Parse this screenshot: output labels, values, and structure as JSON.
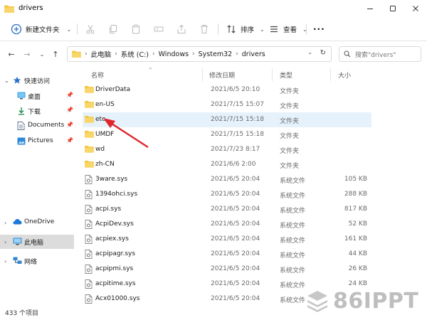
{
  "window": {
    "title": "drivers",
    "controls": [
      "minimize",
      "maximize",
      "close"
    ]
  },
  "toolbar": {
    "new_label": "新建文件夹",
    "sort_label": "排序",
    "view_label": "查看",
    "more_label": "···"
  },
  "address": {
    "breadcrumbs": [
      "此电脑",
      "系统 (C:)",
      "Windows",
      "System32",
      "drivers"
    ],
    "search_placeholder": "搜索\"drivers\""
  },
  "sidebar": {
    "items": [
      {
        "label": "快速访问",
        "icon": "star-icon",
        "expandable": true
      },
      {
        "label": "桌面",
        "icon": "desktop-icon",
        "pinned": true
      },
      {
        "label": "下载",
        "icon": "download-icon",
        "pinned": true
      },
      {
        "label": "Documents",
        "icon": "documents-icon",
        "pinned": true
      },
      {
        "label": "Pictures",
        "icon": "pictures-icon",
        "pinned": true
      },
      {
        "label": "OneDrive",
        "icon": "onedrive-icon",
        "expandable": true
      },
      {
        "label": "此电脑",
        "icon": "this-pc-icon",
        "expandable": true,
        "selected": true
      },
      {
        "label": "网络",
        "icon": "network-icon",
        "expandable": true
      }
    ]
  },
  "columns": {
    "name": "名称",
    "date": "修改日期",
    "type": "类型",
    "size": "大小"
  },
  "files": [
    {
      "name": "DriverData",
      "date": "2021/6/5 20:10",
      "type": "文件夹",
      "size": "",
      "kind": "folder"
    },
    {
      "name": "en-US",
      "date": "2021/7/15 15:07",
      "type": "文件夹",
      "size": "",
      "kind": "folder"
    },
    {
      "name": "etc",
      "date": "2021/7/15 15:18",
      "type": "文件夹",
      "size": "",
      "kind": "folder",
      "highlighted": true
    },
    {
      "name": "UMDF",
      "date": "2021/7/15 15:18",
      "type": "文件夹",
      "size": "",
      "kind": "folder"
    },
    {
      "name": "wd",
      "date": "2021/7/23 8:17",
      "type": "文件夹",
      "size": "",
      "kind": "folder"
    },
    {
      "name": "zh-CN",
      "date": "2021/6/6 2:00",
      "type": "文件夹",
      "size": "",
      "kind": "folder"
    },
    {
      "name": "3ware.sys",
      "date": "2021/6/5 20:04",
      "type": "系统文件",
      "size": "105 KB",
      "kind": "sys"
    },
    {
      "name": "1394ohci.sys",
      "date": "2021/6/5 20:04",
      "type": "系统文件",
      "size": "288 KB",
      "kind": "sys"
    },
    {
      "name": "acpi.sys",
      "date": "2021/6/5 20:04",
      "type": "系统文件",
      "size": "817 KB",
      "kind": "sys"
    },
    {
      "name": "AcpiDev.sys",
      "date": "2021/6/5 20:04",
      "type": "系统文件",
      "size": "52 KB",
      "kind": "sys"
    },
    {
      "name": "acpiex.sys",
      "date": "2021/6/5 20:04",
      "type": "系统文件",
      "size": "161 KB",
      "kind": "sys"
    },
    {
      "name": "acpipagr.sys",
      "date": "2021/6/5 20:04",
      "type": "系统文件",
      "size": "44 KB",
      "kind": "sys"
    },
    {
      "name": "acpipmi.sys",
      "date": "2021/6/5 20:04",
      "type": "系统文件",
      "size": "26 KB",
      "kind": "sys"
    },
    {
      "name": "acpitime.sys",
      "date": "2021/6/5 20:04",
      "type": "系统文件",
      "size": "24 KB",
      "kind": "sys"
    },
    {
      "name": "Acx01000.sys",
      "date": "2021/6/5 20:04",
      "type": "系统文件",
      "size": "",
      "kind": "sys"
    }
  ],
  "status": {
    "item_count": "433 个项目"
  },
  "watermark": {
    "text": "86IPPT"
  },
  "colors": {
    "folder": "#f3c644",
    "highlight_row": "#e5f1fb",
    "selected_nav": "#dcdcdc",
    "annotation_arrow": "#e0262b"
  }
}
